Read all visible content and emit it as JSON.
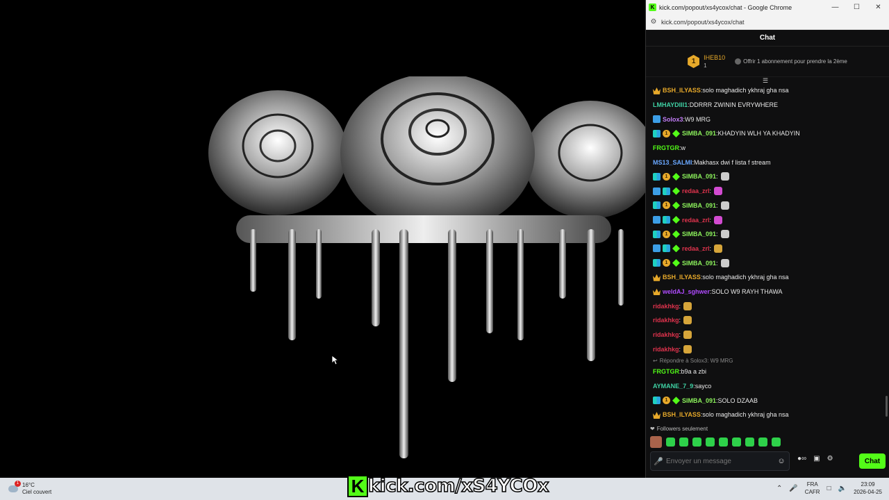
{
  "window": {
    "title": "kick.com/popout/xs4ycox/chat - Google Chrome",
    "url": "kick.com/popout/xs4ycox/chat"
  },
  "chat": {
    "header": "Chat",
    "pinned": {
      "rank": "1",
      "user": "IHEB10",
      "count": "1",
      "gift_text": "Offrir 1 abonnement pour prendre la 2ème"
    },
    "messages": [
      {
        "badges": [
          "crown"
        ],
        "user": "BSH_ILYASS",
        "color": "#e7a92a",
        "text": "solo maghadich ykhraj gha nsa"
      },
      {
        "badges": [],
        "user": "LMHAYDIII1",
        "color": "#3fd1a4",
        "text": "DDRRR ZWININ EVRYWHERE"
      },
      {
        "badges": [
          "blue"
        ],
        "user": "Solox3",
        "color": "#c27ef7",
        "text": "W9 MRG"
      },
      {
        "badges": [
          "cyan",
          "sub",
          "gem"
        ],
        "user": "SIMBA_091",
        "color": "#8cf25c",
        "text": "KHADYIN WLH YA KHADYIN"
      },
      {
        "badges": [],
        "user": "FRGTGR",
        "color": "#53fc18",
        "text": "w"
      },
      {
        "badges": [],
        "user": "MS13_SALMI",
        "color": "#6aa8ff",
        "text": "Makhasx dwi f lista f stream"
      },
      {
        "badges": [
          "cyan",
          "sub",
          "gem"
        ],
        "user": "SIMBA_091",
        "color": "#8cf25c",
        "text": "",
        "emote": "#cccccc"
      },
      {
        "badges": [
          "blue",
          "cyan",
          "gem"
        ],
        "user": "redaa_zrl",
        "color": "#e0334d",
        "text": "",
        "emote": "#d24bd1"
      },
      {
        "badges": [
          "cyan",
          "sub",
          "gem"
        ],
        "user": "SIMBA_091",
        "color": "#8cf25c",
        "text": "",
        "emote": "#cccccc"
      },
      {
        "badges": [
          "blue",
          "cyan",
          "gem"
        ],
        "user": "redaa_zrl",
        "color": "#e0334d",
        "text": "",
        "emote": "#d24bd1"
      },
      {
        "badges": [
          "cyan",
          "sub",
          "gem"
        ],
        "user": "SIMBA_091",
        "color": "#8cf25c",
        "text": "",
        "emote": "#cccccc"
      },
      {
        "badges": [
          "blue",
          "cyan",
          "gem"
        ],
        "user": "redaa_zrl",
        "color": "#e0334d",
        "text": "",
        "emote": "#d6a53a"
      },
      {
        "badges": [
          "cyan",
          "sub",
          "gem"
        ],
        "user": "SIMBA_091",
        "color": "#8cf25c",
        "text": "",
        "emote": "#cccccc"
      },
      {
        "badges": [
          "crown"
        ],
        "user": "BSH_ILYASS",
        "color": "#e7a92a",
        "text": "solo maghadich ykhraj gha nsa"
      },
      {
        "badges": [
          "crown"
        ],
        "user": "weldAJ_sghwer",
        "color": "#b04bff",
        "text": "SOLO W9 RAYH THAWA"
      },
      {
        "badges": [],
        "user": "ridakhkg",
        "color": "#e0334d",
        "text": "",
        "emote": "#d6a53a"
      },
      {
        "badges": [],
        "user": "ridakhkg",
        "color": "#e0334d",
        "text": "",
        "emote": "#d6a53a"
      },
      {
        "badges": [],
        "user": "ridakhkg",
        "color": "#e0334d",
        "text": "",
        "emote": "#d6a53a"
      },
      {
        "badges": [],
        "user": "ridakhkg",
        "color": "#e0334d",
        "text": "",
        "emote": "#d6a53a"
      }
    ],
    "reply_note": "Répondre à Solox3: W9 MRG",
    "messages_after": [
      {
        "badges": [],
        "user": "FRGTGR",
        "color": "#53fc18",
        "text": "b9a a zbi"
      },
      {
        "badges": [],
        "user": "AYMANE_7_9",
        "color": "#3fd1a4",
        "text": "sayco"
      },
      {
        "badges": [
          "cyan",
          "sub",
          "gem"
        ],
        "user": "SIMBA_091",
        "color": "#8cf25c",
        "text": "SOLO DZAAB"
      },
      {
        "badges": [
          "crown"
        ],
        "user": "BSH_ILYASS",
        "color": "#e7a92a",
        "text": "solo maghadich ykhraj gha nsa"
      }
    ],
    "followers_only": "Followers seulement",
    "input_placeholder": "Envoyer un message",
    "send_label": "Chat"
  },
  "taskbar": {
    "temp": "16°C",
    "weather": "Ciel couvert",
    "notif_count": "1",
    "brand_k": "K",
    "brand_text": "kick.com/xS4YCOx",
    "lang1": "FRA",
    "lang2": "CAFR",
    "time": "23:09",
    "date": "2026-04-25"
  }
}
